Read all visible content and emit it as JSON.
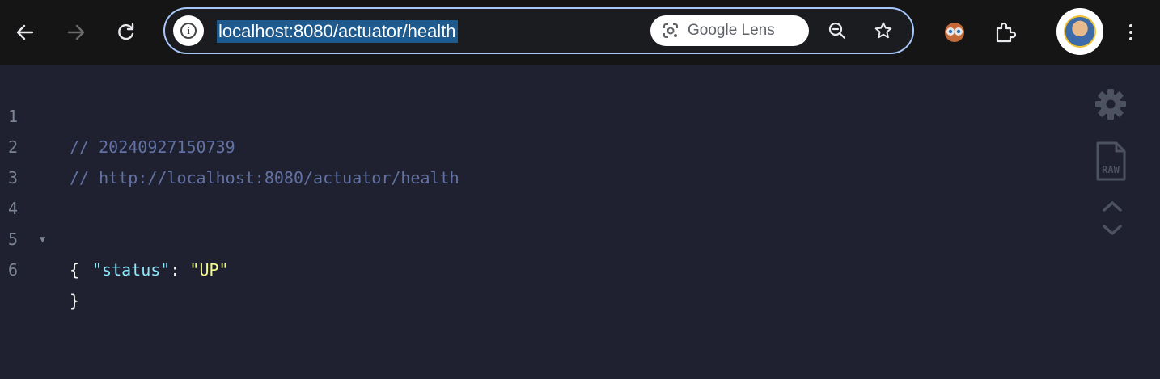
{
  "toolbar": {
    "url": "localhost:8080/actuator/health",
    "lens_label": "Google Lens",
    "icons": [
      "back-arrow-icon",
      "forward-arrow-icon",
      "reload-icon",
      "site-info-icon",
      "google-lens-icon",
      "zoom-icon",
      "bookmark-star-icon",
      "extension-icon",
      "puzzle-extensions-icon",
      "profile-avatar",
      "more-menu-icon"
    ]
  },
  "viewer": {
    "lines": [
      {
        "number": "1",
        "comment": "// 20240927150739"
      },
      {
        "number": "2",
        "comment": "// http://localhost:8080/actuator/health"
      },
      {
        "number": "3"
      },
      {
        "number": "4",
        "open_brace": "{"
      },
      {
        "number": "5",
        "key": "\"status\"",
        "colon": ": ",
        "value": "\"UP\""
      },
      {
        "number": "6",
        "close_brace": "}"
      }
    ],
    "side_tools": [
      "settings-gear-icon",
      "raw-view-icon",
      "collapse-up-icon",
      "expand-down-icon"
    ],
    "raw_label": "RAW"
  },
  "colors": {
    "background": "#1f2130",
    "comment": "#6272a4",
    "key": "#8be9fd",
    "string": "#f1fa8c",
    "line_number": "#7e8596",
    "url_highlight": "#1f5a8e",
    "omnibox_border": "#a8c7fa"
  }
}
